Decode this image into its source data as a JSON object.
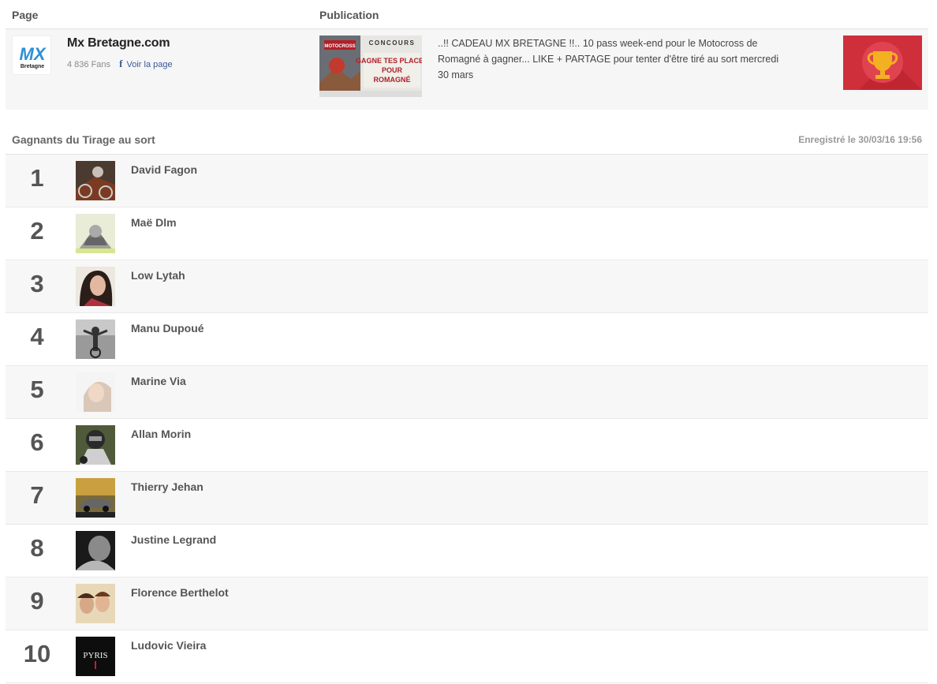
{
  "header": {
    "page_col": "Page",
    "publication_col": "Publication"
  },
  "page": {
    "logo_text_top": "MX",
    "logo_text_bottom": "Bretagne",
    "name": "Mx Bretagne.com",
    "fans": "4 836 Fans",
    "fb_icon": "f",
    "view_link": "Voir la page"
  },
  "publication": {
    "thumb_top": "CONCOURS",
    "thumb_label_1": "GAGNE TES PLACES",
    "thumb_label_2": "POUR",
    "thumb_label_3": "ROMAGNÉ",
    "thumb_sub": "MOTOCROSS",
    "text": "..!! CADEAU MX BRETAGNE !!.. 10 pass week-end pour le Motocross de Romagné à gagner... LIKE + PARTAGE pour tenter d'être tiré au sort mercredi 30 mars",
    "trophy_icon": "trophy-icon"
  },
  "draw": {
    "title": "Gagnants du Tirage au sort",
    "recorded": "Enregistré le 30/03/16 19:56"
  },
  "winners": [
    {
      "rank": "1",
      "name": "David Fagon"
    },
    {
      "rank": "2",
      "name": "Maë Dlm"
    },
    {
      "rank": "3",
      "name": "Low Lytah"
    },
    {
      "rank": "4",
      "name": "Manu Dupoué"
    },
    {
      "rank": "5",
      "name": "Marine Via"
    },
    {
      "rank": "6",
      "name": "Allan Morin"
    },
    {
      "rank": "7",
      "name": "Thierry Jehan"
    },
    {
      "rank": "8",
      "name": "Justine Legrand"
    },
    {
      "rank": "9",
      "name": "Florence Berthelot"
    },
    {
      "rank": "10",
      "name": "Ludovic Vieira",
      "avatar_text": "PYRIS"
    }
  ],
  "colors": {
    "trophy_bg": "#cf2f3a",
    "trophy_gold": "#f3b020",
    "fb_blue": "#3b5998"
  }
}
